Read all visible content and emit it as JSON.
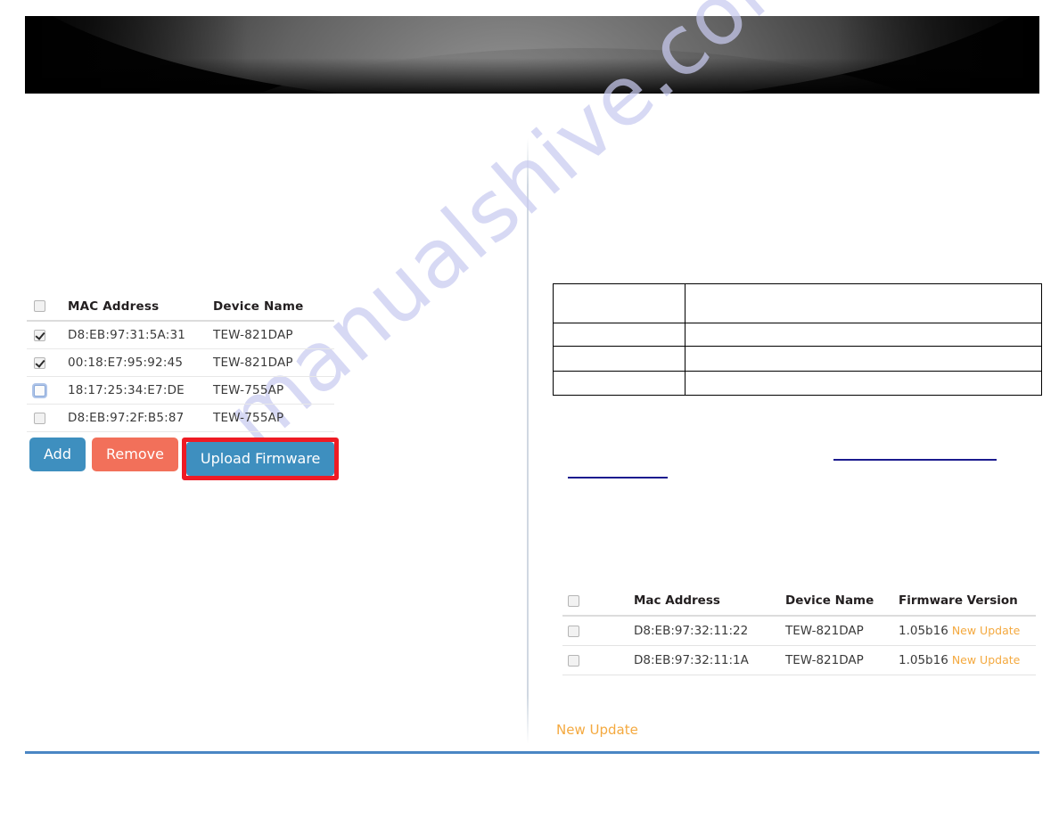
{
  "banner": {
    "name": "product-banner",
    "background_color": "#040404",
    "accent_color": "#8a8a8a"
  },
  "watermark": {
    "text": "manualshive.com",
    "color": "#c9cbf0"
  },
  "colors": {
    "button_blue": "#3e8fbf",
    "button_red": "#f2705a",
    "highlight_red": "#ee1b24",
    "link_orange": "#f4a93f",
    "link_blue": "#1b1b8f",
    "rule_blue": "#4a86c4"
  },
  "left_panel": {
    "device_table": {
      "name": "device-list-table",
      "select_all_checked": false,
      "columns": [
        "",
        "MAC Address",
        "Device Name"
      ],
      "headers": {
        "mac": "MAC Address",
        "device": "Device Name"
      },
      "rows": [
        {
          "checked": true,
          "focused": false,
          "mac": "D8:EB:97:31:5A:31",
          "device": "TEW-821DAP"
        },
        {
          "checked": true,
          "focused": false,
          "mac": "00:18:E7:95:92:45",
          "device": "TEW-821DAP"
        },
        {
          "checked": false,
          "focused": true,
          "mac": "18:17:25:34:E7:DE",
          "device": "TEW-755AP"
        },
        {
          "checked": false,
          "focused": false,
          "mac": "D8:EB:97:2F:B5:87",
          "device": "TEW-755AP"
        }
      ]
    },
    "buttons": {
      "add_label": "Add",
      "remove_label": "Remove",
      "upload_label": "Upload Firmware",
      "upload_highlighted": true
    }
  },
  "right_panel": {
    "spec_table": {
      "name": "blank-spec-table",
      "rows": [
        {
          "col1": "",
          "col2": ""
        },
        {
          "col1": "",
          "col2": ""
        },
        {
          "col1": "",
          "col2": ""
        },
        {
          "col1": "",
          "col2": ""
        }
      ]
    },
    "links": [
      {
        "name": "reference-link-upper",
        "text": ""
      },
      {
        "name": "reference-link-lower",
        "text": ""
      }
    ],
    "firmware_table": {
      "name": "firmware-version-table",
      "select_all_checked": false,
      "headers": {
        "mac": "Mac Address",
        "device": "Device Name",
        "firmware": "Firmware Version"
      },
      "rows": [
        {
          "checked": false,
          "mac": "D8:EB:97:32:11:22",
          "device": "TEW-821DAP",
          "version": "1.05b16",
          "update_label": "New Update"
        },
        {
          "checked": false,
          "mac": "D8:EB:97:32:11:1A",
          "device": "TEW-821DAP",
          "version": "1.05b16",
          "update_label": "New Update"
        }
      ]
    },
    "new_update_caption": "New Update"
  }
}
